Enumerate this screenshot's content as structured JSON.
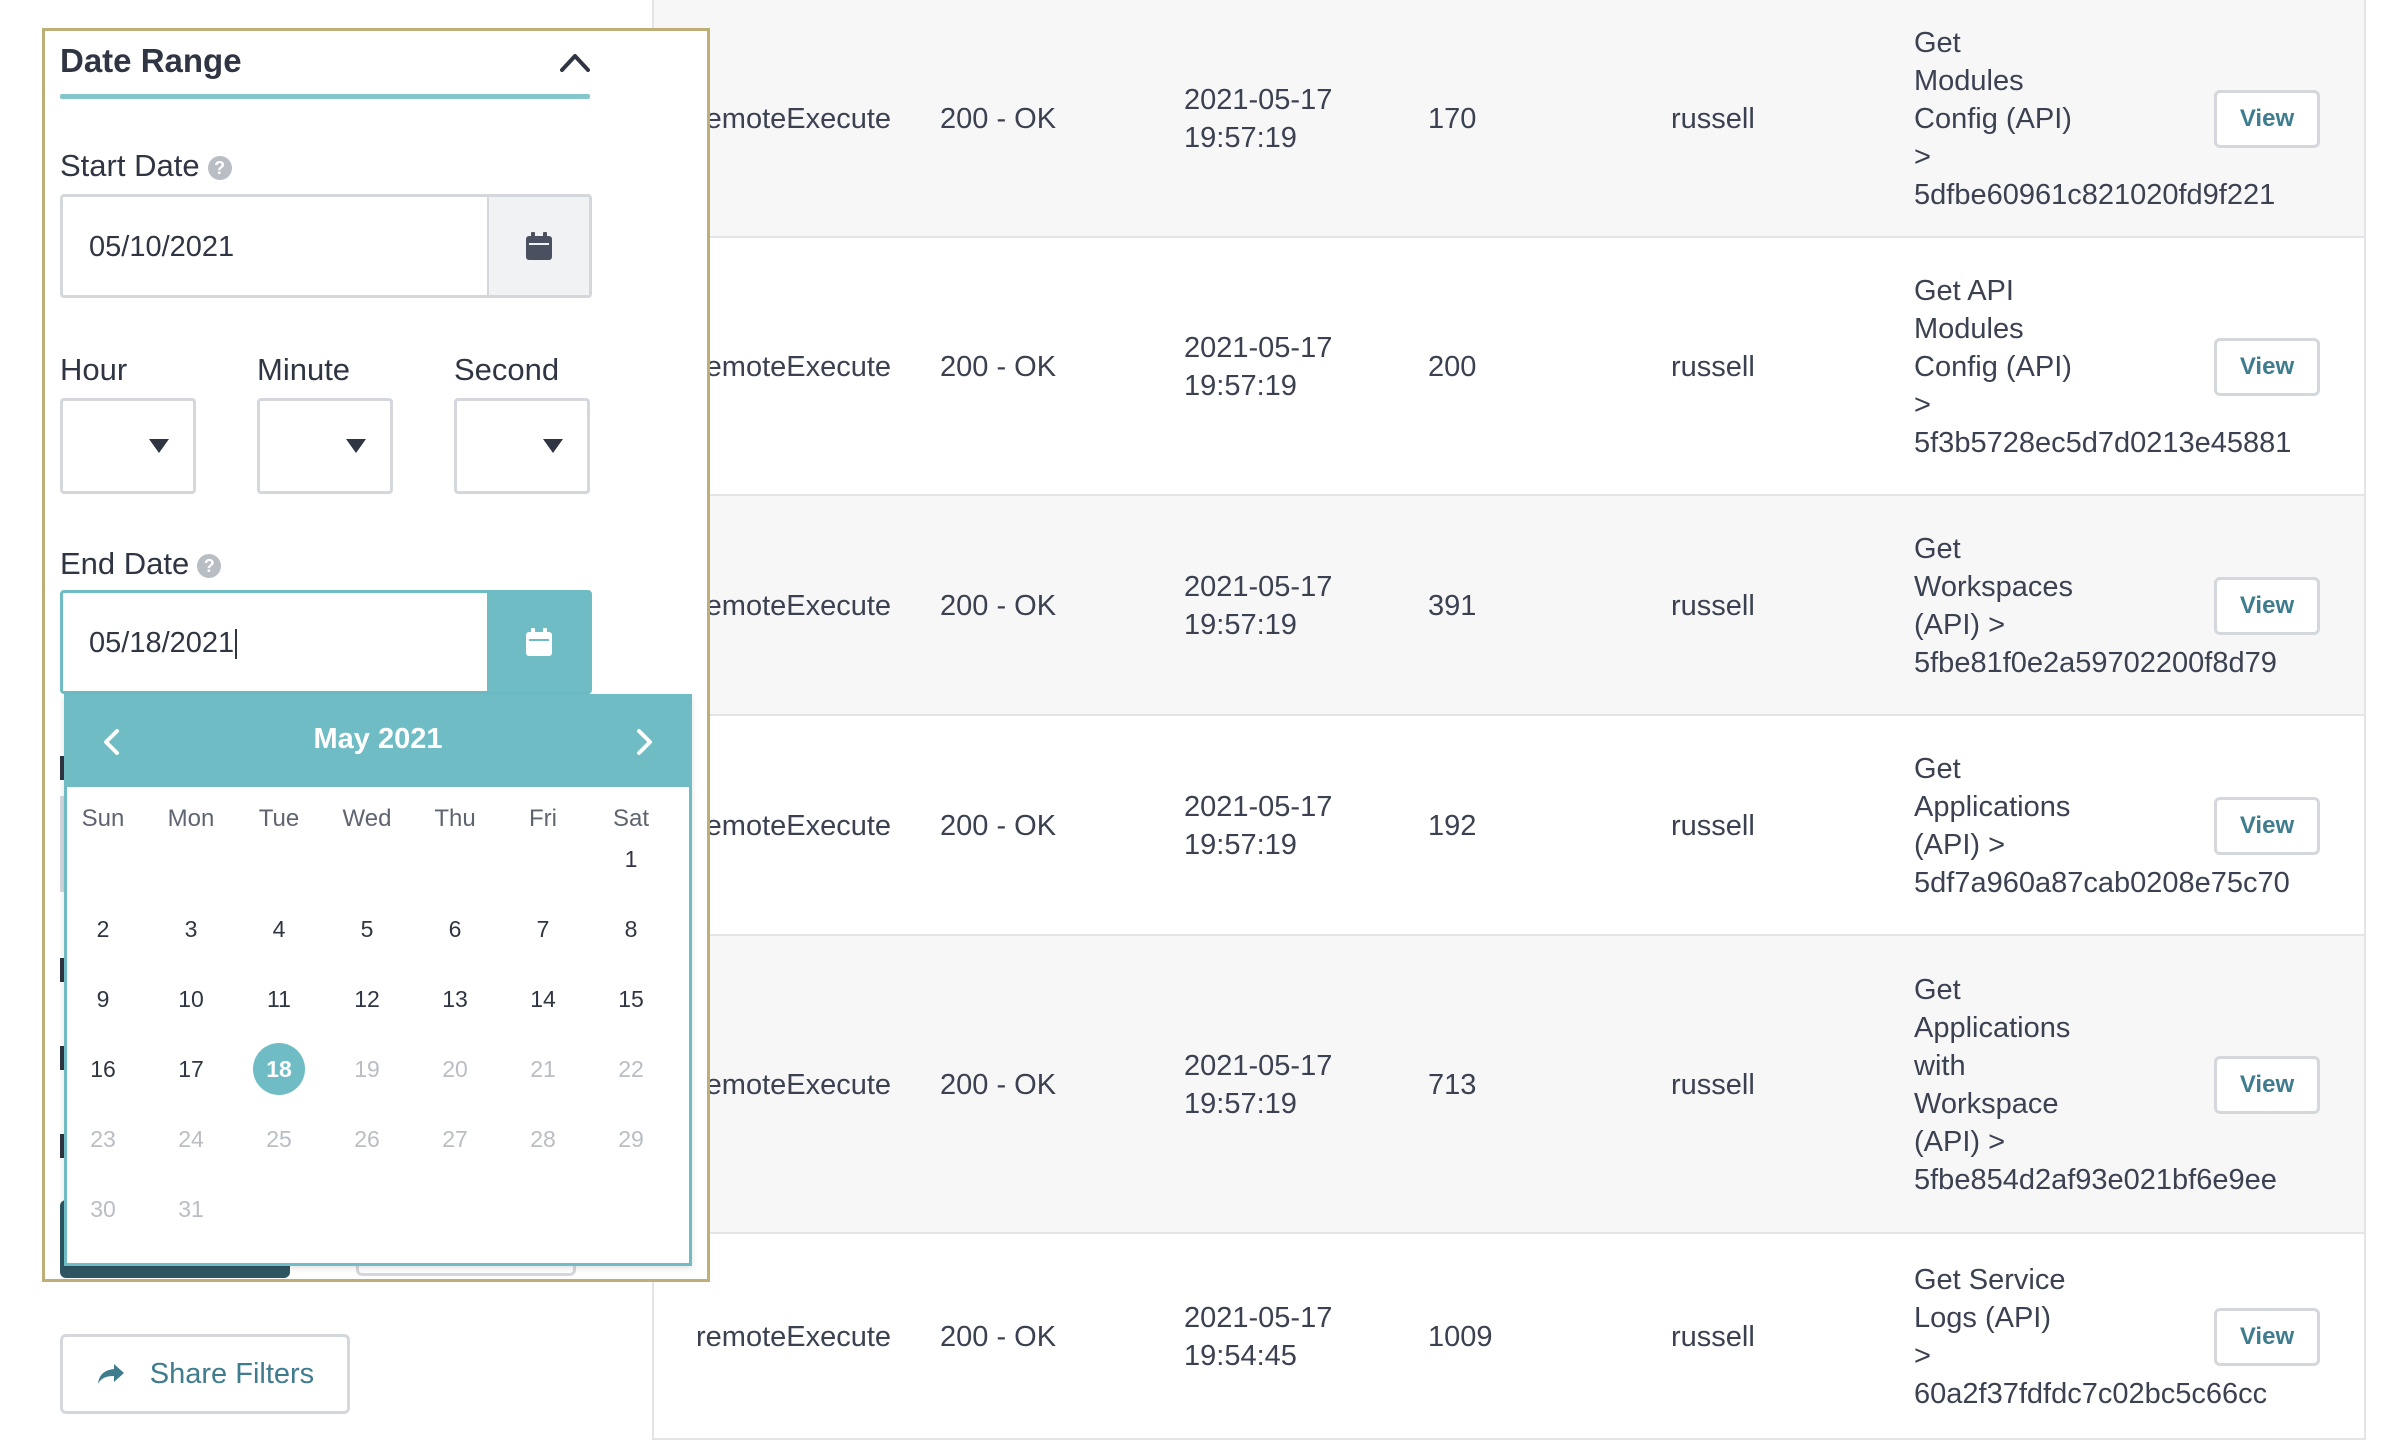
{
  "filter_panel": {
    "section_title": "Date Range",
    "start_date": {
      "label": "Start Date",
      "value": "05/10/2021"
    },
    "time": {
      "hour_label": "Hour",
      "minute_label": "Minute",
      "second_label": "Second"
    },
    "end_date": {
      "label": "End Date",
      "value": "05/18/2021"
    },
    "share_label": "Share Filters",
    "help_glyph": "?"
  },
  "calendar": {
    "month_label": "May  2021",
    "weekdays": [
      "Sun",
      "Mon",
      "Tue",
      "Wed",
      "Thu",
      "Fri",
      "Sat"
    ],
    "selected_day": 18,
    "max_enabled_day": 18,
    "first_weekday_index": 6,
    "days_in_month": 31,
    "accent": "#6fbcc5"
  },
  "table": {
    "view_label": "View",
    "rows": [
      {
        "function": "remoteExecute",
        "status": "200 - OK",
        "date": "2021-05-17",
        "time": "19:57:19",
        "duration": "170",
        "user": "russell",
        "description": [
          "Get",
          "Modules",
          "Config (API)",
          ">",
          "5dfbe60961c821020fd9f221"
        ]
      },
      {
        "function": "remoteExecute",
        "status": "200 - OK",
        "date": "2021-05-17",
        "time": "19:57:19",
        "duration": "200",
        "user": "russell",
        "description": [
          "Get API",
          "Modules",
          "Config (API)",
          ">",
          "5f3b5728ec5d7d0213e45881"
        ]
      },
      {
        "function": "remoteExecute",
        "status": "200 - OK",
        "date": "2021-05-17",
        "time": "19:57:19",
        "duration": "391",
        "user": "russell",
        "description": [
          "Get",
          "Workspaces",
          "(API) >",
          "5fbe81f0e2a59702200f8d79"
        ]
      },
      {
        "function": "remoteExecute",
        "status": "200 - OK",
        "date": "2021-05-17",
        "time": "19:57:19",
        "duration": "192",
        "user": "russell",
        "description": [
          "Get",
          "Applications",
          "(API) >",
          "5df7a960a87cab0208e75c70"
        ]
      },
      {
        "function": "remoteExecute",
        "status": "200 - OK",
        "date": "2021-05-17",
        "time": "19:57:19",
        "duration": "713",
        "user": "russell",
        "description": [
          "Get",
          "Applications",
          "with",
          "Workspace",
          "(API) >",
          "5fbe854d2af93e021bf6e9ee"
        ]
      },
      {
        "function": "remoteExecute",
        "status": "200 - OK",
        "date": "2021-05-17",
        "time": "19:54:45",
        "duration": "1009",
        "user": "russell",
        "description": [
          "Get Service",
          "Logs (API)",
          ">",
          "60a2f37fdfdc7c02bc5c66cc"
        ]
      }
    ]
  }
}
